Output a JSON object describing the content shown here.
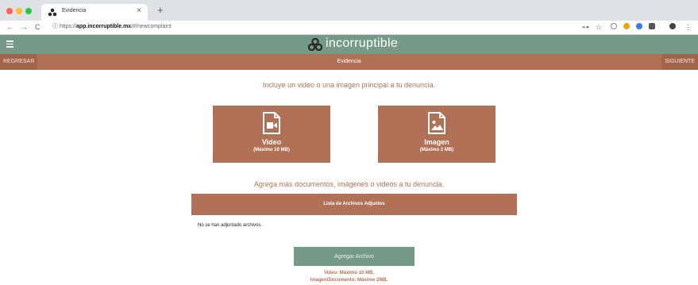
{
  "browser": {
    "tab_title": "Evidencia",
    "tab_close": "×",
    "new_tab": "+",
    "url_scheme": "https://",
    "url_host": "app.incorruptible.mx",
    "url_path": "/#/newcomplaint",
    "back_icon": "←",
    "forward_icon": "→",
    "reload_icon": "C",
    "info_icon": "ⓘ",
    "key_icon": "⊶",
    "star_icon": "☆",
    "menu_dots": "⋮"
  },
  "app": {
    "brand": "incorruptible",
    "accent_green": "#759a87",
    "accent_brown": "#b07156"
  },
  "subnav": {
    "back_label": "REGRESAR",
    "title": "Evidencia",
    "next_label": "SIGUIENTE"
  },
  "main": {
    "intro": "Incluye un video o una imagen principal a tu denuncia.",
    "cards": [
      {
        "title": "Video",
        "subtitle": "(Máximo 10 MB)",
        "icon": "video-file-icon"
      },
      {
        "title": "Imagen",
        "subtitle": "(Máximo 2 MB)",
        "icon": "image-file-icon"
      }
    ],
    "more_prompt": "Agrega más documentos, imágenes o videos a tu denuncia.",
    "attachments_header": "Lista de Archivos Adjuntos",
    "no_files": "No se han adjuntado archivos.",
    "add_button": "Agregar Archivo",
    "limit_video": "Video: Máximo 10 MB.",
    "limit_other": "Imagen/Documento: Máximo 2MB."
  }
}
